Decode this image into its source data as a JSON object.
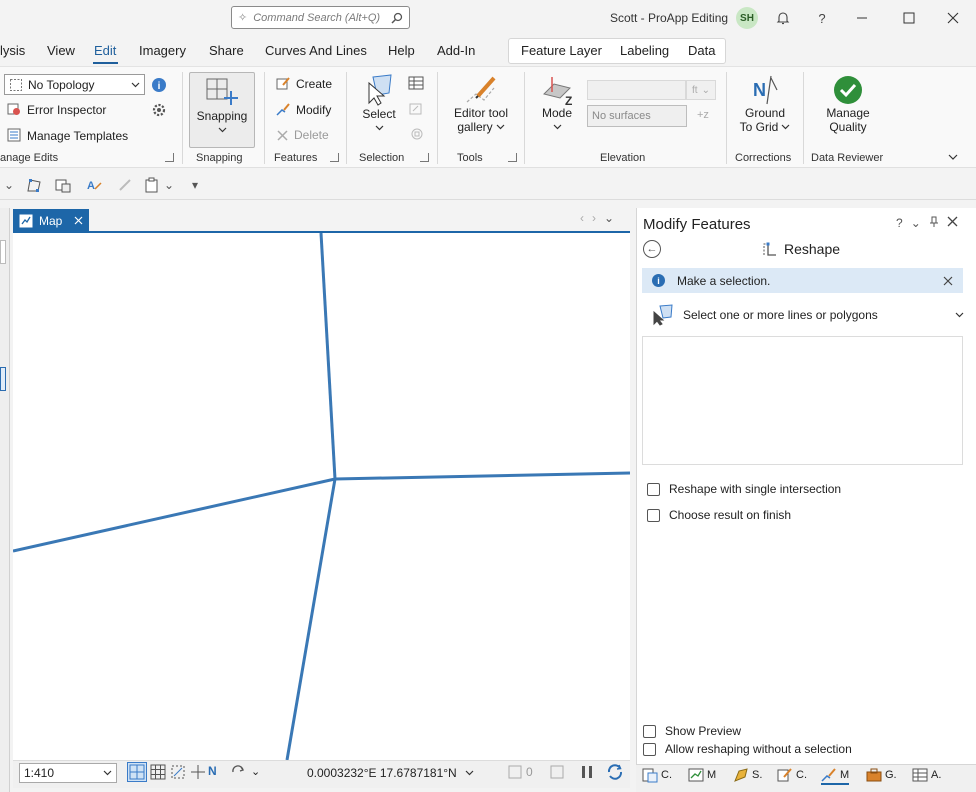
{
  "titlebar": {
    "search_placeholder": "Command Search (Alt+Q)",
    "app_title": "Scott - ProApp Editing",
    "avatar_initials": "SH"
  },
  "menu": {
    "tabs": [
      "lysis",
      "View",
      "Edit",
      "Imagery",
      "Share",
      "Curves And Lines",
      "Help",
      "Add-In"
    ],
    "active": "Edit",
    "context_tabs": [
      "Feature Layer",
      "Labeling",
      "Data"
    ]
  },
  "ribbon": {
    "manage_edits": {
      "topology_value": "No Topology",
      "error_inspector": "Error Inspector",
      "manage_templates": "Manage Templates",
      "group_label": "anage Edits"
    },
    "snapping": {
      "button": "Snapping",
      "group_label": "Snapping"
    },
    "features": {
      "create": "Create",
      "modify": "Modify",
      "delete": "Delete",
      "group_label": "Features"
    },
    "selection": {
      "select": "Select",
      "group_label": "Selection"
    },
    "tools": {
      "gallery_line1": "Editor tool",
      "gallery_line2": "gallery",
      "group_label": "Tools"
    },
    "elevation": {
      "mode": "Mode",
      "unit": "ft",
      "surface_value": "No surfaces",
      "group_label": "Elevation"
    },
    "corrections": {
      "line1": "Ground",
      "line2": "To Grid",
      "group_label": "Corrections"
    },
    "data_reviewer": {
      "line1": "Manage",
      "line2": "Quality",
      "group_label": "Data Reviewer"
    }
  },
  "map": {
    "tab_label": "Map",
    "scale": "1:410",
    "coordinates": "0.0003232°E 17.6787181°N",
    "selected_count": "0"
  },
  "pane": {
    "title": "Modify Features",
    "help": "?",
    "tool_name": "Reshape",
    "info_message": "Make a selection.",
    "select_prompt": "Select one or more lines or polygons",
    "option_single_intersection": "Reshape with single intersection",
    "option_choose_result": "Choose result on finish",
    "option_show_preview": "Show Preview",
    "option_allow_without_selection": "Allow reshaping without a selection"
  },
  "dock_tabs": [
    {
      "icon": "catalog-icon",
      "label": "C."
    },
    {
      "icon": "map-icon",
      "label": "M"
    },
    {
      "icon": "symbology-icon",
      "label": "S."
    },
    {
      "icon": "create-features-icon",
      "label": "C."
    },
    {
      "icon": "modify-features-icon",
      "label": "M"
    },
    {
      "icon": "geoprocessing-icon",
      "label": "G."
    },
    {
      "icon": "attributes-icon",
      "label": "A."
    }
  ],
  "colors": {
    "accent": "#1d66a8",
    "line_feature": "#3a78b5",
    "info_bar": "#dce9f6",
    "check_green": "#2f8f3a"
  }
}
